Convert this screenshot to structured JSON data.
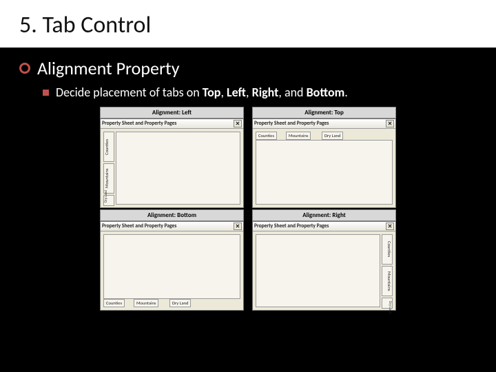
{
  "title": "5. Tab Control",
  "bullet": "Alignment Property",
  "subtext": {
    "prefix": "Decide placement of tabs on ",
    "a": "Top",
    "sep1": ", ",
    "b": "Left",
    "sep2": ", ",
    "c": "Right",
    "sep3": ", and ",
    "d": "Bottom",
    "suffix": "."
  },
  "captions": {
    "left": "Alignment: Left",
    "top": "Alignment: Top",
    "bottom": "Alignment: Bottom",
    "right": "Alignment: Right"
  },
  "dialog_title": "Property Sheet and Property Pages",
  "close_glyph": "✕",
  "tabs": {
    "t1": "Counties",
    "t2": "Mountains",
    "t3": "Dry Land"
  }
}
